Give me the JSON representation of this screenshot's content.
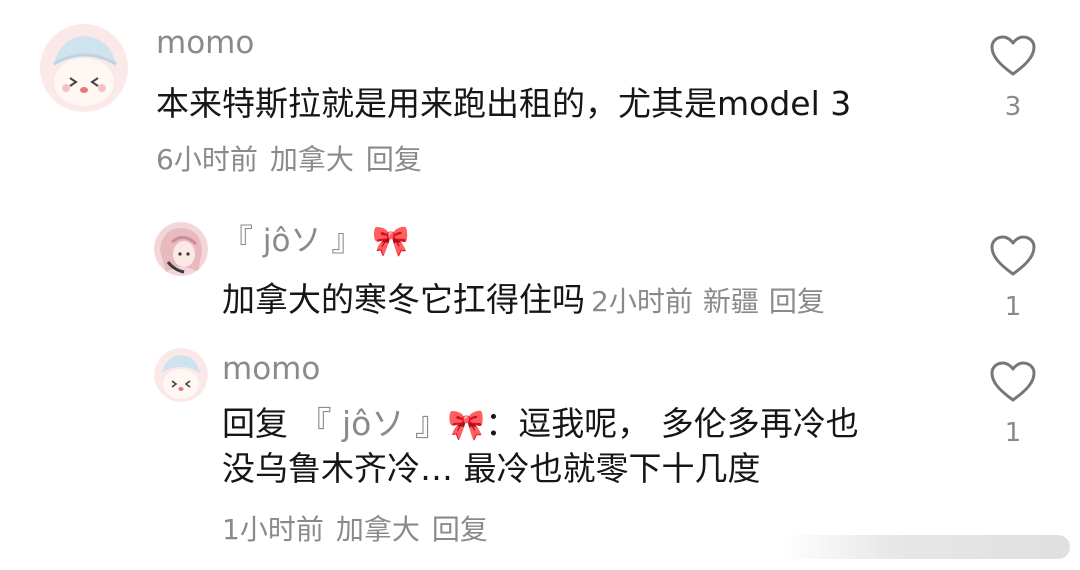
{
  "comments": [
    {
      "username": "momo",
      "text": "本来特斯拉就是用来跑出租的，尤其是model 3",
      "time": "6小时前",
      "location": "加拿大",
      "reply_label": "回复",
      "like_count": "3"
    },
    {
      "username": "『 jôソ 』",
      "username_emoji": "🎀",
      "text": "加拿大的寒冬它扛得住吗",
      "time": "2小时前",
      "location": "新疆",
      "reply_label": "回复",
      "like_count": "1"
    },
    {
      "username": "momo",
      "text_line1_prefix": "回复 ",
      "text_line1_mention": "『 jôソ 』",
      "text_line1_emoji": "🎀",
      "text_line1_rest": "：逗我呢， 多伦多再冷也",
      "text_line2": "没乌鲁木齐冷… 最冷也就零下十几度",
      "time": "1小时前",
      "location": "加拿大",
      "reply_label": "回复",
      "like_count": "1"
    }
  ],
  "icons": {
    "like": "heart-outline-icon"
  },
  "colors": {
    "muted_text": "#8a8a8a",
    "body_text": "#161616",
    "background": "#ffffff"
  }
}
